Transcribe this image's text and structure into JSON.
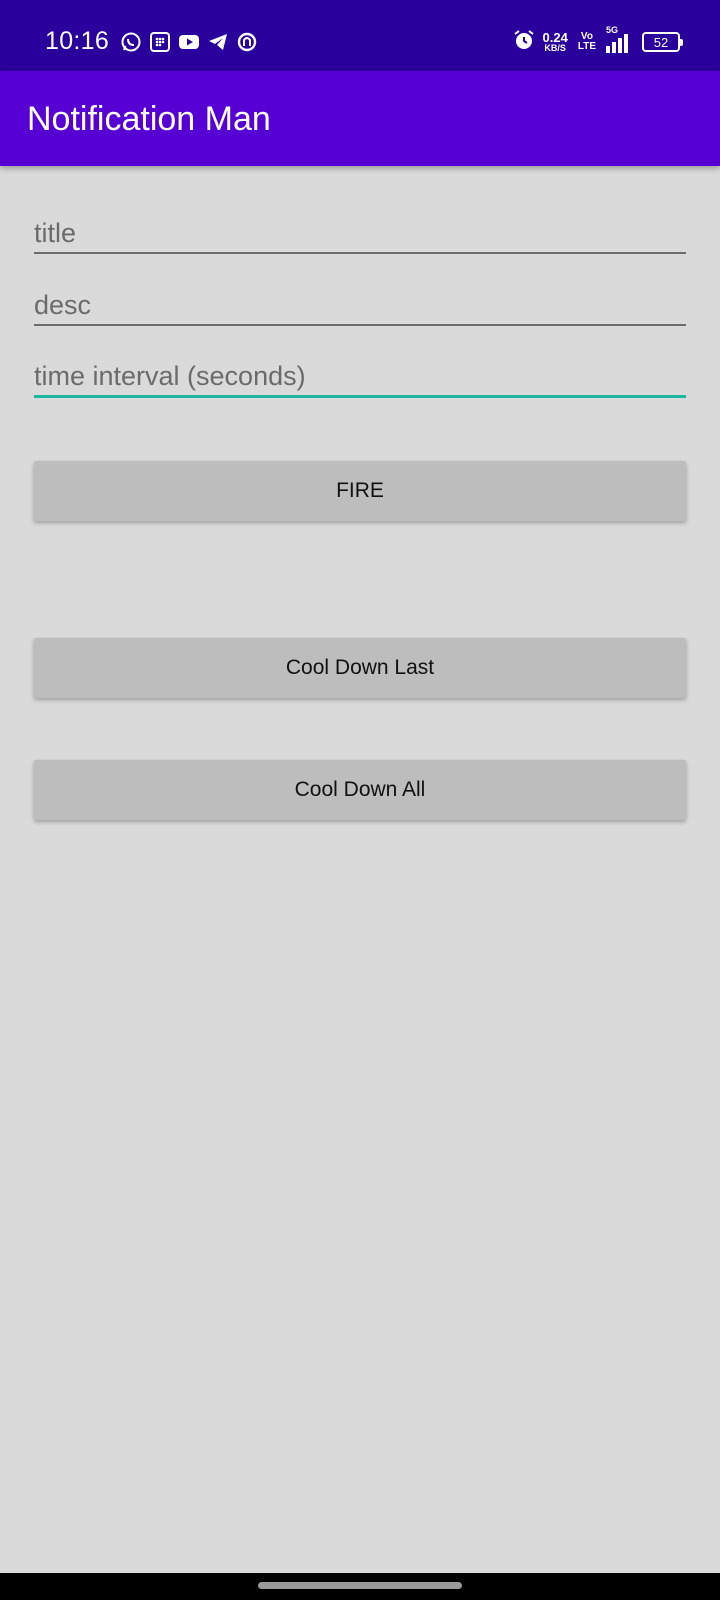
{
  "status_bar": {
    "time": "10:16",
    "left_icons": [
      "whatsapp-icon",
      "app-grid-icon",
      "youtube-icon",
      "telegram-icon",
      "app-icon"
    ],
    "net_speed_value": "0.24",
    "net_speed_unit": "KB/S",
    "volte_top": "Vo",
    "volte_bottom": "LTE",
    "network_type": "5G",
    "battery": "52"
  },
  "app_bar": {
    "title": "Notification Man",
    "color": "#5600d3"
  },
  "form": {
    "title_placeholder": "title",
    "desc_placeholder": "desc",
    "interval_placeholder": "time interval (seconds)",
    "focused_accent": "#1fb5a3"
  },
  "buttons": {
    "fire": "FIRE",
    "cool_down_last": "Cool Down Last",
    "cool_down_all": "Cool Down All"
  }
}
